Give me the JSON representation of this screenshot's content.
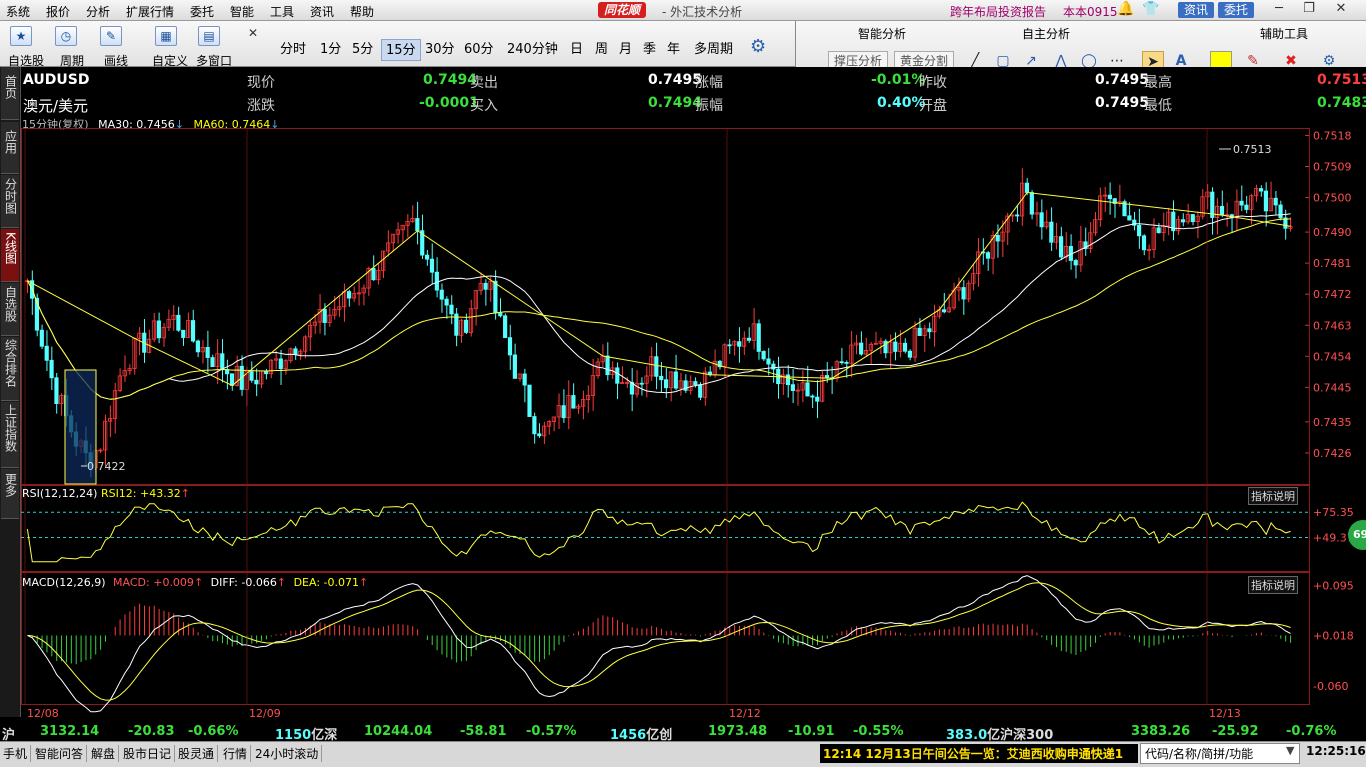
{
  "menu": [
    "系统",
    "报价",
    "分析",
    "扩展行情",
    "委托",
    "智能",
    "工具",
    "资讯",
    "帮助"
  ],
  "brand": "同花顺",
  "app_title": "- 外汇技术分析",
  "promo_link": "跨年布局投资报告",
  "version": "本本0915",
  "top_buttons": {
    "news": "资讯",
    "trade": "委托"
  },
  "toolbar": {
    "tools": [
      "自选股",
      "周期",
      "画线",
      "自定义",
      "多窗口"
    ],
    "periods": [
      "分时",
      "1分",
      "5分",
      "15分",
      "30分",
      "60分",
      "240分钟",
      "日",
      "周",
      "月",
      "季",
      "年",
      "多周期"
    ],
    "selected_period": "15分"
  },
  "right_panel": {
    "sections": [
      "智能分析",
      "自主分析",
      "辅助工具"
    ],
    "buttons": [
      "撑压分析",
      "黄金分割"
    ]
  },
  "left_tabs": [
    "首页",
    "应用",
    "分时图",
    "K线图",
    "自选股",
    "综合排名",
    "上证指数",
    "更多"
  ],
  "quote": {
    "symbol": "AUDUSD",
    "name": "澳元/美元",
    "fields": [
      {
        "label": "现价",
        "value": "0.7494"
      },
      {
        "label": "卖出",
        "value": "0.7495"
      },
      {
        "label": "涨幅",
        "value": "-0.01%"
      },
      {
        "label": "昨收",
        "value": "0.7495"
      },
      {
        "label": "最高",
        "value": "0.7513"
      },
      {
        "label": "涨跌",
        "value": "-0.0001"
      },
      {
        "label": "买入",
        "value": "0.7494"
      },
      {
        "label": "振幅",
        "value": "0.40%"
      },
      {
        "label": "开盘",
        "value": "0.7495"
      },
      {
        "label": "最低",
        "value": "0.7483"
      }
    ]
  },
  "kline_legend": {
    "period": "15分钟(复权)",
    "ma30": "MA30: 0.7456",
    "ma60": "MA60: 0.7464"
  },
  "rsi_legend": {
    "name": "RSI(12,12,24)",
    "value": "RSI12: +43.32"
  },
  "macd_legend": {
    "name": "MACD(12,26,9)",
    "macd": "MACD: +0.009",
    "diff": "DIFF: -0.066",
    "dea": "DEA: -0.071"
  },
  "indicator_help": "指标说明",
  "badge": "69",
  "chart_data": {
    "type": "candlestick",
    "price_axis": [
      "0.7518",
      "0.7509",
      "0.7500",
      "0.7490",
      "0.7481",
      "0.7472",
      "0.7463",
      "0.7454",
      "0.7445",
      "0.7435",
      "0.7426"
    ],
    "rsi_axis": [
      "+75.35",
      "+49.37"
    ],
    "macd_axis": [
      "+0.095",
      "+0.018",
      "-0.060"
    ],
    "date_labels": [
      "12/08",
      "12/09",
      "12/12",
      "12/13"
    ],
    "high_marker": "0.7513",
    "low_marker": "0.7422",
    "close_series": [
      0.7476,
      0.7462,
      0.7448,
      0.7438,
      0.743,
      0.7424,
      0.7428,
      0.744,
      0.7452,
      0.7456,
      0.7459,
      0.7462,
      0.7465,
      0.7462,
      0.7458,
      0.7455,
      0.7452,
      0.7449,
      0.7446,
      0.7448,
      0.745,
      0.7453,
      0.7457,
      0.746,
      0.7463,
      0.7466,
      0.7469,
      0.7472,
      0.7476,
      0.748,
      0.7484,
      0.7488,
      0.7493,
      0.7486,
      0.7476,
      0.7466,
      0.746,
      0.747,
      0.7478,
      0.7466,
      0.7456,
      0.7446,
      0.7436,
      0.7432,
      0.7436,
      0.744,
      0.7444,
      0.7448,
      0.7452,
      0.745,
      0.7446,
      0.7448,
      0.7452,
      0.7449,
      0.7448,
      0.7447,
      0.7446,
      0.745,
      0.7454,
      0.7458,
      0.7462,
      0.7458,
      0.7452,
      0.7447,
      0.7444,
      0.7442,
      0.7445,
      0.7448,
      0.7452,
      0.7455,
      0.7456,
      0.7455,
      0.7454,
      0.7456,
      0.7459,
      0.7462,
      0.7466,
      0.747,
      0.7475,
      0.748,
      0.7486,
      0.7492,
      0.7497,
      0.7502,
      0.7496,
      0.749,
      0.7484,
      0.748,
      0.7488,
      0.7496,
      0.7503,
      0.7498,
      0.7492,
      0.7488,
      0.749,
      0.7493,
      0.7495,
      0.7497,
      0.7499,
      0.7497,
      0.7496,
      0.7498,
      0.75,
      0.7497,
      0.7495,
      0.7494
    ]
  }
}
